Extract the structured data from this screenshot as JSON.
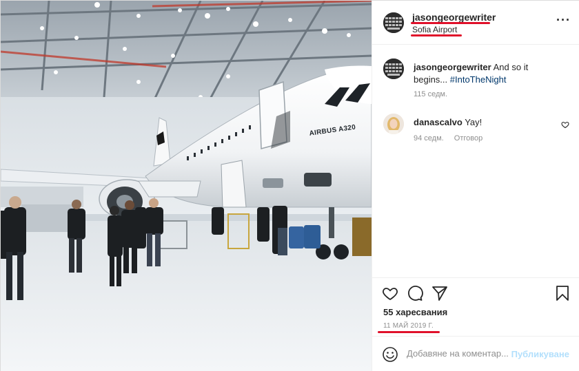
{
  "post": {
    "username": "jasongeorgewriter",
    "location": "Sofia Airport",
    "more_icon": "more-horizontal-icon"
  },
  "photo": {
    "aircraft_label": "AIRBUS A320",
    "alt": "Airbus A320 in hangar"
  },
  "caption": {
    "username": "jasongeorgewriter",
    "text": "And so it begins... ",
    "hashtag": "#IntoTheNight",
    "age": "115 седм."
  },
  "comments": [
    {
      "username": "danascalvo",
      "text": "Yay!",
      "age": "94 седм.",
      "reply_label": "Отговор"
    }
  ],
  "actions": {
    "like_icon": "heart-icon",
    "comment_icon": "comment-icon",
    "share_icon": "paper-plane-icon",
    "save_icon": "bookmark-icon"
  },
  "likes_text": "55 харесвания",
  "date_text": "11 МАЙ 2019 Г.",
  "add_comment": {
    "placeholder": "Добавяне на коментар...",
    "publish_label": "Публикуване"
  },
  "colors": {
    "annotation_red": "#e0102a",
    "link_blue": "#00376b",
    "publish_disabled": "#b2dffc",
    "muted_text": "#8e8e8e"
  }
}
